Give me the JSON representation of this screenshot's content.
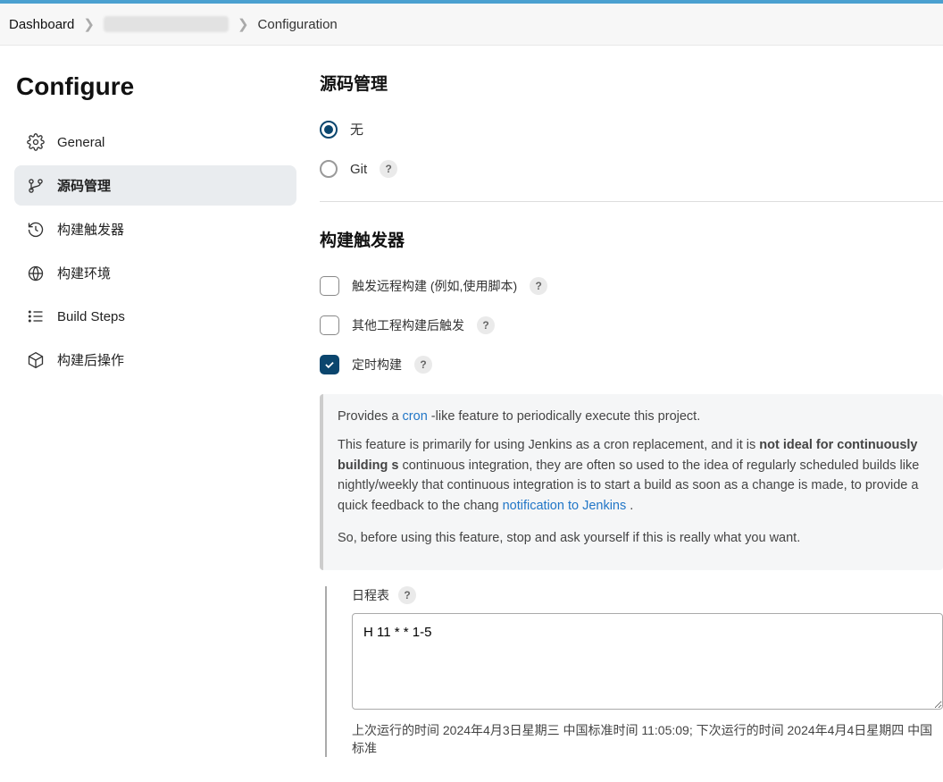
{
  "breadcrumb": {
    "dashboard": "Dashboard",
    "project": "████████",
    "current": "Configuration"
  },
  "sidebar": {
    "title": "Configure",
    "items": [
      {
        "label": "General"
      },
      {
        "label": "源码管理"
      },
      {
        "label": "构建触发器"
      },
      {
        "label": "构建环境"
      },
      {
        "label": "Build Steps"
      },
      {
        "label": "构建后操作"
      }
    ]
  },
  "scm": {
    "title": "源码管理",
    "options": {
      "none": "无",
      "git": "Git"
    }
  },
  "triggers": {
    "title": "构建触发器",
    "remote": "触发远程构建 (例如,使用脚本)",
    "after_other": "其他工程构建后触发",
    "scheduled": "定时构建"
  },
  "help_panel": {
    "line1_a": "Provides a ",
    "line1_link": "cron",
    "line1_b": " -like feature to periodically execute this project.",
    "line2_a": "This feature is primarily for using Jenkins as a cron replacement, and it is ",
    "line2_strong": "not ideal for continuously building s",
    "line2_b": " continuous integration, they are often so used to the idea of regularly scheduled builds like nightly/weekly that continuous integration is to start a build as soon as a change is made, to provide a quick feedback to the chang",
    "link2": "notification to Jenkins",
    "line2_c": " .",
    "line3": "So, before using this feature, stop and ask yourself if this is really what you want."
  },
  "schedule": {
    "label": "日程表",
    "value": "H 11 * * 1-5",
    "note": "上次运行的时间 2024年4月3日星期三 中国标准时间 11:05:09; 下次运行的时间 2024年4月4日星期四 中国标准"
  }
}
